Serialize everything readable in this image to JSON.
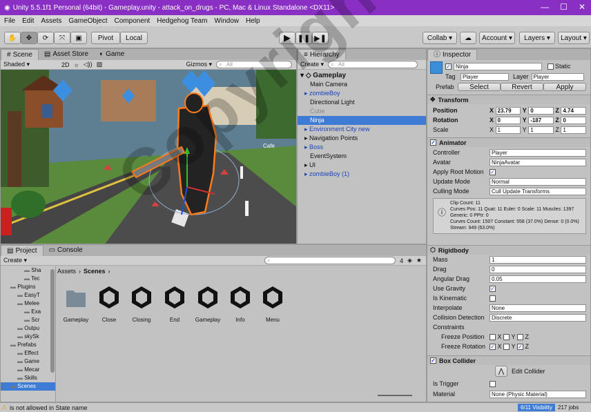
{
  "window": {
    "title": "Unity 5.5.1f1 Personal (64bit) - Gameplay.unity - attack_on_drugs - PC, Mac & Linux Standalone <DX11>"
  },
  "menu": [
    "File",
    "Edit",
    "Assets",
    "GameObject",
    "Component",
    "Hedgehog Team",
    "Window",
    "Help"
  ],
  "toolbar": {
    "pivot": "Pivot",
    "local": "Local",
    "collab": "Collab",
    "account": "Account",
    "layers": "Layers",
    "layout": "Layout"
  },
  "scene_panel": {
    "tabs": [
      "Scene",
      "Asset Store",
      "Game"
    ],
    "shaded": "Shaded",
    "mode_2d": "2D",
    "gizmos": "Gizmos",
    "search_placeholder": "All",
    "sign_text": "Cafe"
  },
  "hierarchy": {
    "tab": "Hierarchy",
    "create": "Create",
    "search_placeholder": "All",
    "scene": "Gameplay",
    "items": [
      {
        "label": "Main Camera",
        "style": ""
      },
      {
        "label": "zombieBoy",
        "style": "blue",
        "arrow": true
      },
      {
        "label": "Directional Light",
        "style": ""
      },
      {
        "label": "Cube",
        "style": "grey"
      },
      {
        "label": "Ninja",
        "style": "sel"
      },
      {
        "label": "Environment City new",
        "style": "blue",
        "arrow": true
      },
      {
        "label": "Navigation Points",
        "style": "",
        "arrow": true
      },
      {
        "label": "Boss",
        "style": "blue",
        "arrow": true
      },
      {
        "label": "EventSystem",
        "style": ""
      },
      {
        "label": "UI",
        "style": "",
        "arrow": true
      },
      {
        "label": "zombieBoy (1)",
        "style": "blue",
        "arrow": true
      }
    ]
  },
  "inspector": {
    "tab": "Inspector",
    "object_name": "Ninja",
    "static": "Static",
    "tag_label": "Tag",
    "tag": "Player",
    "layer_label": "Layer",
    "layer": "Player",
    "prefab_label": "Prefab",
    "prefab_select": "Select",
    "prefab_revert": "Revert",
    "prefab_apply": "Apply",
    "transform": {
      "title": "Transform",
      "position_label": "Position",
      "position": {
        "x": "23.79",
        "y": "0",
        "z": "4.74"
      },
      "rotation_label": "Rotation",
      "rotation": {
        "x": "0",
        "y": "-187",
        "z": "0"
      },
      "scale_label": "Scale",
      "scale": {
        "x": "1",
        "y": "1",
        "z": "1"
      }
    },
    "animator": {
      "title": "Animator",
      "controller_label": "Controller",
      "controller": "Player",
      "avatar_label": "Avatar",
      "avatar": "NinjaAvatar",
      "root_motion_label": "Apply Root Motion",
      "update_mode_label": "Update Mode",
      "update_mode": "Normal",
      "culling_label": "Culling Mode",
      "culling": "Cull Update Transforms",
      "info": [
        "Clip Count: 11",
        "Curves Pos: 11 Quat: 11 Euler: 0 Scale: 11 Muscles: 1397",
        "Generic: 0 PPtr: 0",
        "Curves Count: 1507 Constant: 558 (37.0%) Dense: 0 (0.0%)",
        "Stream: 949 (63.0%)"
      ]
    },
    "rigidbody": {
      "title": "Rigidbody",
      "mass_label": "Mass",
      "mass": "1",
      "drag_label": "Drag",
      "drag": "0",
      "angular_drag_label": "Angular Drag",
      "angular_drag": "0.05",
      "use_gravity_label": "Use Gravity",
      "is_kinematic_label": "Is Kinematic",
      "interpolate_label": "Interpolate",
      "interpolate": "None",
      "collision_label": "Collision Detection",
      "collision": "Discrete",
      "constraints_label": "Constraints",
      "freeze_pos_label": "Freeze Position",
      "freeze_rot_label": "Freeze Rotation"
    },
    "box_collider": {
      "title": "Box Collider",
      "edit_collider": "Edit Collider",
      "is_trigger_label": "Is Trigger",
      "material_label": "Material",
      "material": "None (Physic Material)"
    }
  },
  "project": {
    "tabs": [
      "Project",
      "Console"
    ],
    "create": "Create",
    "breadcrumb_root": "Assets",
    "breadcrumb_current": "Scenes",
    "tree": [
      {
        "label": "Sha",
        "indent": 3
      },
      {
        "label": "Tec",
        "indent": 3
      },
      {
        "label": "Plugins",
        "indent": 1
      },
      {
        "label": "EasyT",
        "indent": 2
      },
      {
        "label": "Melee",
        "indent": 2
      },
      {
        "label": "Exa",
        "indent": 3
      },
      {
        "label": "Scr",
        "indent": 3
      },
      {
        "label": "Outpu",
        "indent": 2
      },
      {
        "label": "skySk",
        "indent": 2
      },
      {
        "label": "Prefabs",
        "indent": 1
      },
      {
        "label": "Effect",
        "indent": 2
      },
      {
        "label": "Game",
        "indent": 2
      },
      {
        "label": "Mecar",
        "indent": 2
      },
      {
        "label": "Skills",
        "indent": 2
      },
      {
        "label": "Scenes",
        "indent": 1
      }
    ],
    "assets": [
      "Gameplay",
      "Close",
      "Closing",
      "End",
      "Gameplay",
      "Info",
      "Menu"
    ],
    "count_badge": "4"
  },
  "status": {
    "message": "is not allowed in State name",
    "visibility": "6/11 Visibility",
    "jobs": "217 jobs"
  },
  "watermark": "Copyright@FTE"
}
